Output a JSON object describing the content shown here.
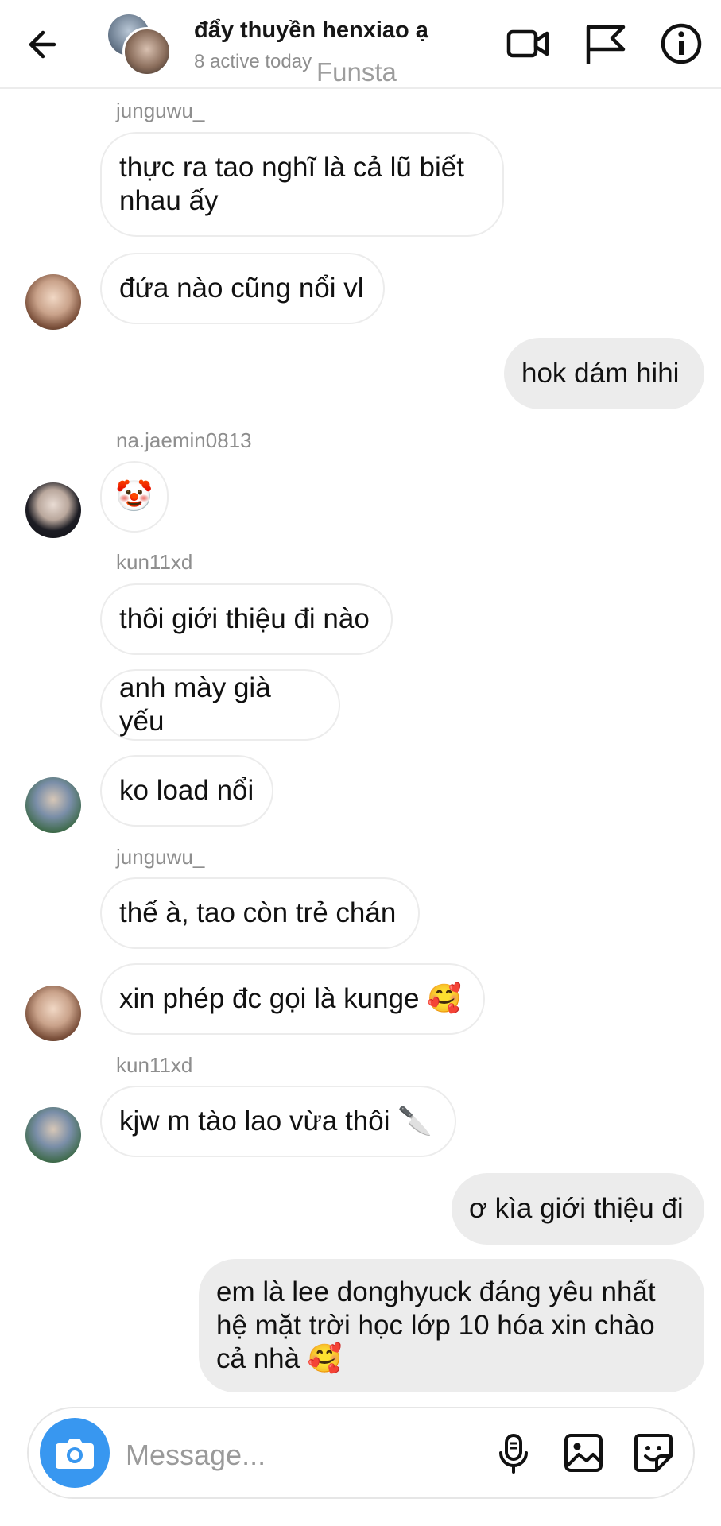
{
  "header": {
    "title": "đẩy thuyền henxiao ạ",
    "subtitle": "8 active today",
    "watermark": "Funsta",
    "icons": [
      "back-arrow-icon",
      "video-call-icon",
      "flag-icon",
      "info-icon"
    ]
  },
  "messages": [
    {
      "sender": "junguwu_",
      "side": "in",
      "text": "thực ra tao nghĩ là cả lũ biết\nnhau ấy"
    },
    {
      "side": "in",
      "text": "đứa nào cũng nổi vl"
    },
    {
      "side": "out",
      "text": "hok dám hihi"
    },
    {
      "sender": "na.jaemin0813",
      "side": "in",
      "text": "🤡"
    },
    {
      "sender": "kun11xd",
      "side": "in",
      "text": "thôi giới thiệu đi nào"
    },
    {
      "side": "in",
      "text": "anh mày già yếu"
    },
    {
      "side": "in",
      "text": "ko load nổi"
    },
    {
      "sender": "junguwu_",
      "side": "in",
      "text": "thế à, tao còn trẻ chán"
    },
    {
      "side": "in",
      "text": "xin phép đc gọi là kunge 🥰"
    },
    {
      "sender": "kun11xd",
      "side": "in",
      "text": "kjw m tào lao vừa thôi 🔪"
    },
    {
      "side": "out",
      "text": "ơ kìa giới thiệu đi"
    },
    {
      "side": "out",
      "text": "em là lee donghyuck đáng yêu nhất\nhệ mặt trời học lớp 10 hóa xin chào\ncả nhà 🥰"
    }
  ],
  "composer": {
    "placeholder": "Message...",
    "icons": [
      "camera-icon",
      "microphone-icon",
      "gallery-icon",
      "sticker-icon"
    ]
  },
  "colors": {
    "accent": "#3897f0",
    "outgoing_bubble": "#ececec",
    "incoming_border": "#ececec",
    "secondary_text": "#8e8e8e"
  }
}
